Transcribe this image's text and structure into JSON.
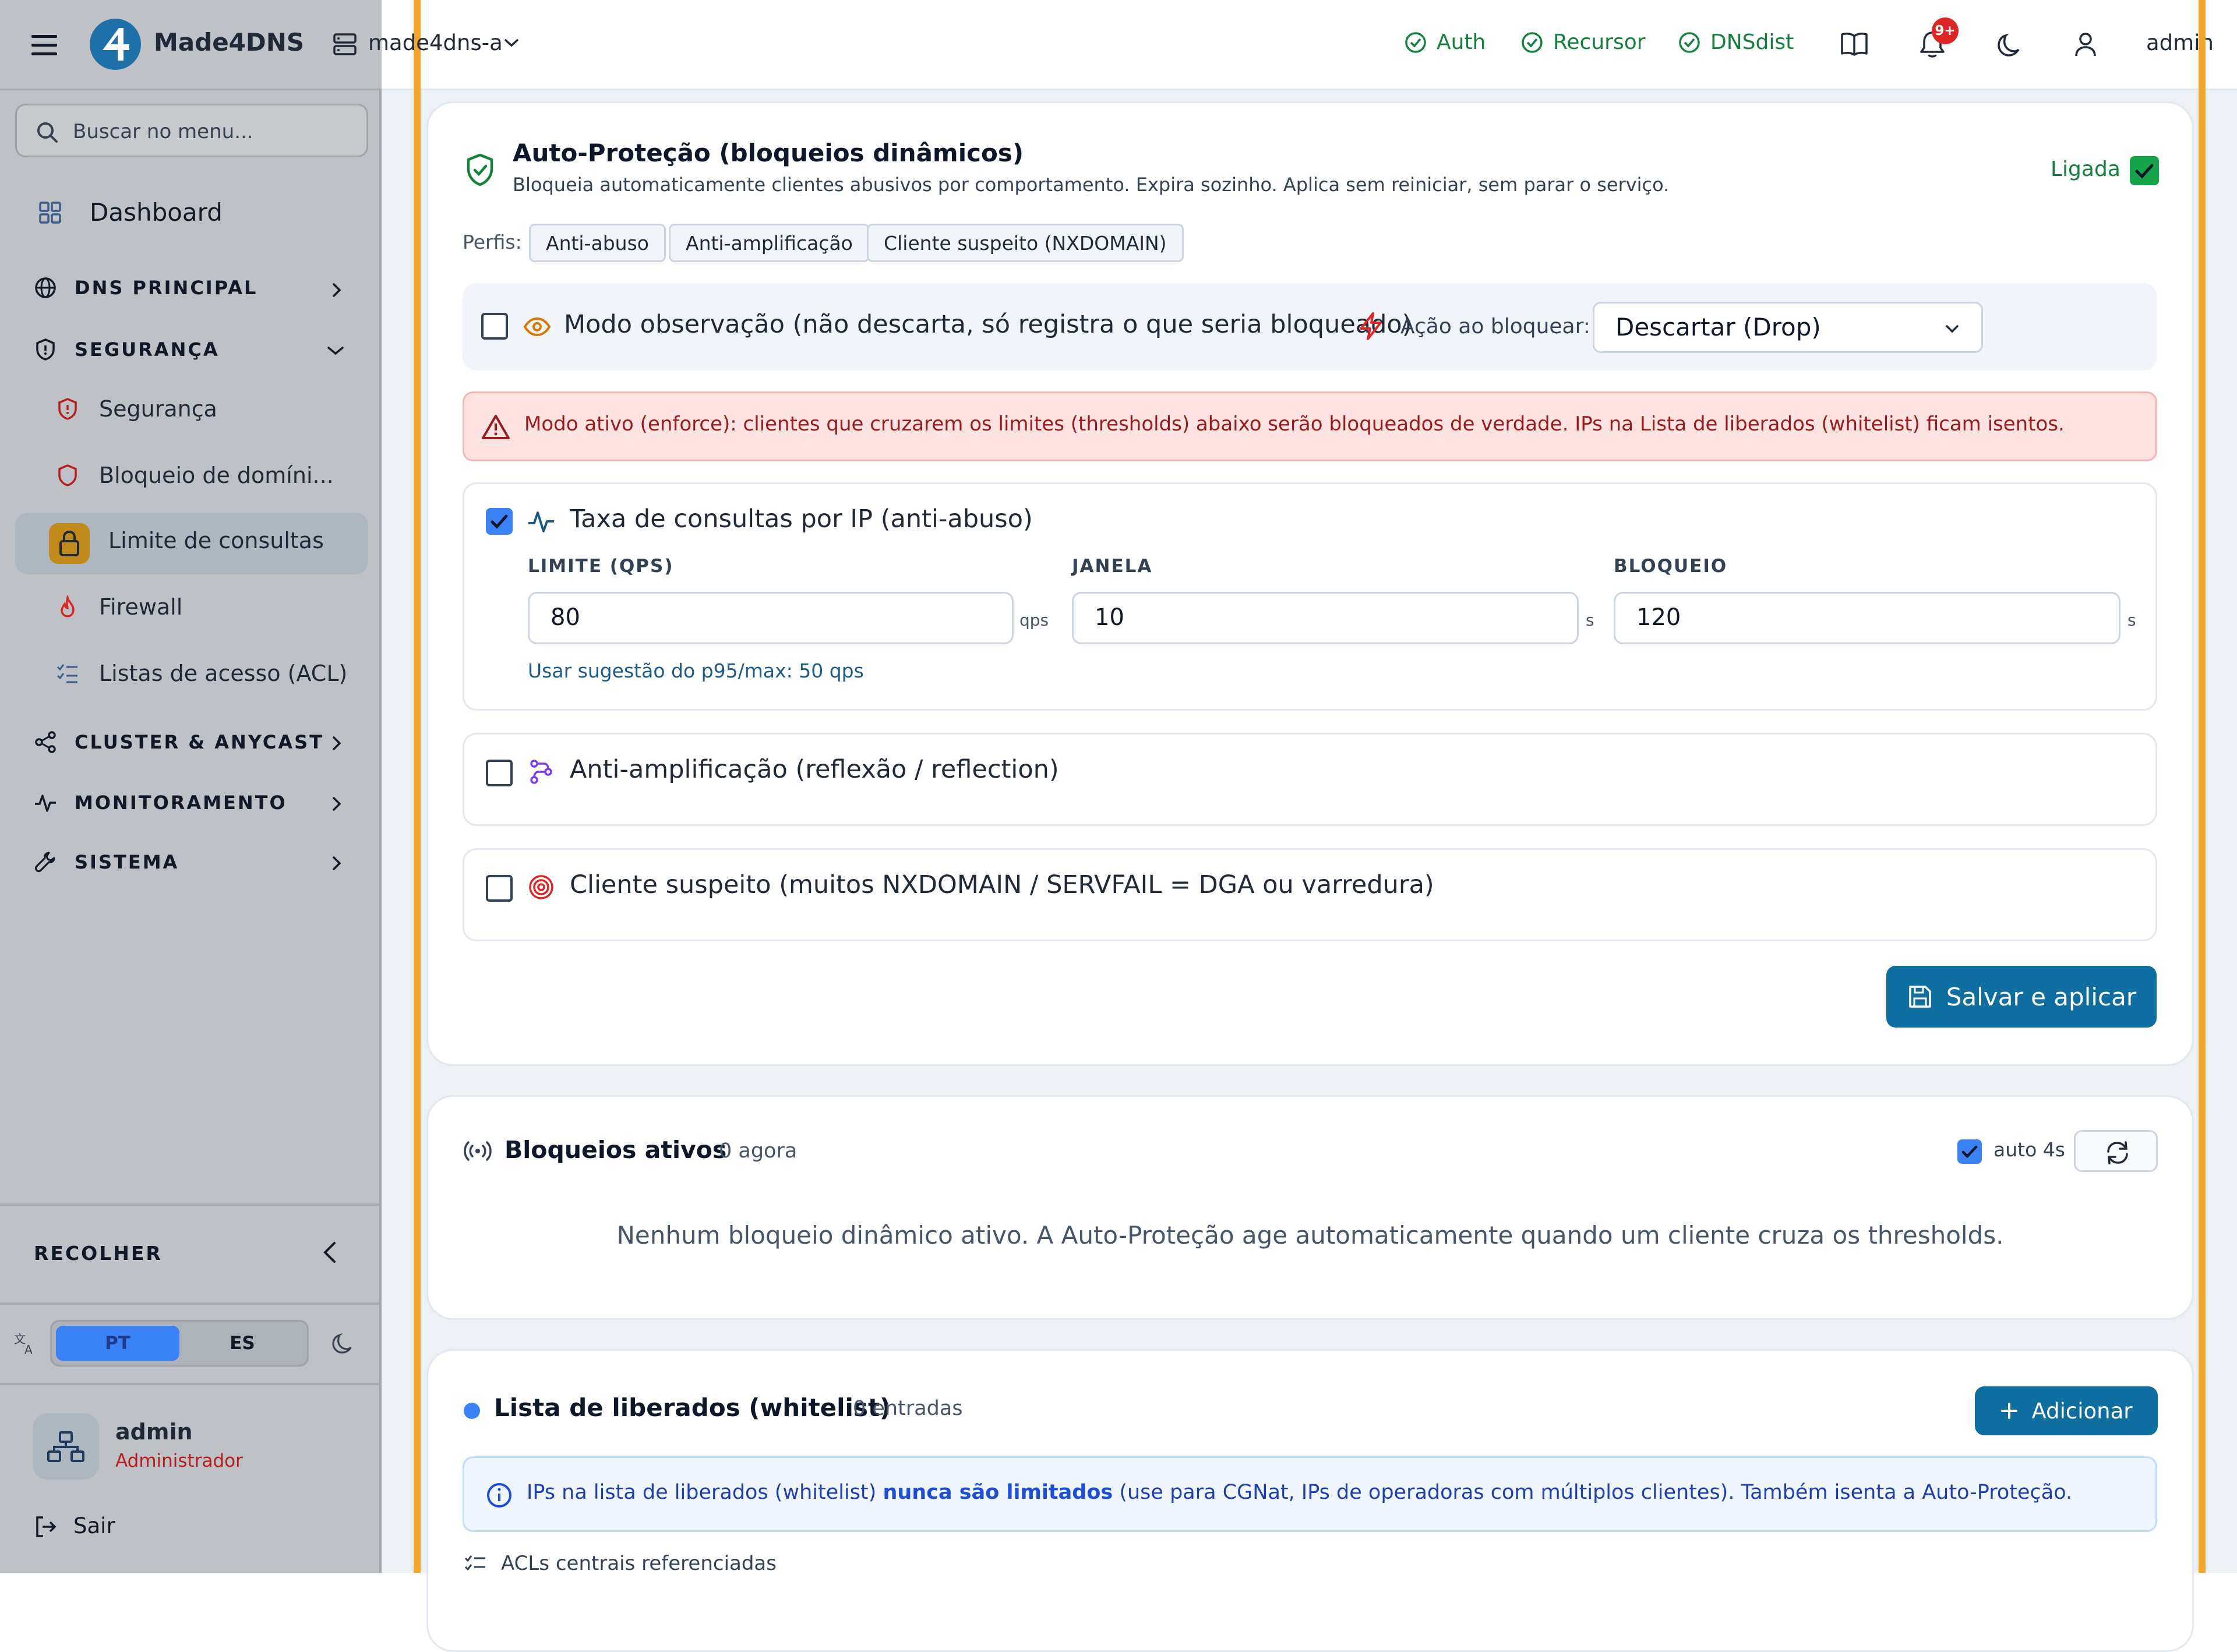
{
  "app": {
    "brand": "Made4DNS",
    "server_selector": "made4dns-a",
    "user_label": "admin"
  },
  "topbar": {
    "services": [
      {
        "label": "Auth"
      },
      {
        "label": "Recursor"
      },
      {
        "label": "DNSdist"
      }
    ],
    "notifications_badge": "9+"
  },
  "sidebar": {
    "search_placeholder": "Buscar no menu...",
    "dashboard": "Dashboard",
    "sections": {
      "dns_principal": "DNS PRINCIPAL",
      "seguranca": "SEGURANÇA",
      "cluster": "CLUSTER & ANYCAST",
      "monitoramento": "MONITORAMENTO",
      "sistema": "SISTEMA"
    },
    "security_items": {
      "seguranca": "Segurança",
      "bloqueio": "Bloqueio de domíni...",
      "limite": "Limite de consultas",
      "firewall": "Firewall",
      "acl": "Listas de acesso (ACL)"
    },
    "collapse_label": "RECOLHER",
    "languages": {
      "pt": "PT",
      "es": "ES",
      "selected": "PT"
    },
    "user": {
      "name": "admin",
      "role": "Administrador"
    },
    "logout": "Sair"
  },
  "autoprotect": {
    "title": "Auto-Proteção (bloqueios dinâmicos)",
    "description": "Bloqueia automaticamente clientes abusivos por comportamento. Expira sozinho. Aplica sem reiniciar, sem parar o serviço.",
    "enabled_label": "Ligada",
    "enabled": true,
    "profiles_label": "Perfis:",
    "profiles": {
      "p1": "Anti-abuso",
      "p2": "Anti-amplificação",
      "p3": "Cliente suspeito (NXDOMAIN)"
    },
    "observe_mode_label": "Modo observação (não descarta, só registra o que seria bloqueado)",
    "observe_mode": false,
    "action_label": "Ação ao bloquear:",
    "action_value": "Descartar (Drop)",
    "alert": "Modo ativo (enforce): clientes que cruzarem os limites (thresholds) abaixo serão bloqueados de verdade. IPs na Lista de liberados (whitelist) ficam isentos.",
    "rate": {
      "title": "Taxa de consultas por IP (anti-abuso)",
      "enabled": true,
      "limit_label": "LIMITE (QPS)",
      "limit_value": "80",
      "limit_unit": "qps",
      "window_label": "JANELA",
      "window_value": "10",
      "window_unit": "s",
      "block_label": "BLOQUEIO",
      "block_value": "120",
      "block_unit": "s",
      "suggestion": "Usar sugestão do p95/max: 50 qps"
    },
    "amplification": {
      "title": "Anti-amplificação (reflexão / reflection)",
      "enabled": false
    },
    "suspect": {
      "title": "Cliente suspeito (muitos NXDOMAIN / SERVFAIL = DGA ou varredura)",
      "enabled": false
    },
    "save_label": "Salvar e aplicar"
  },
  "active_blocks": {
    "title": "Bloqueios ativos",
    "meta": "0 agora",
    "auto_label": "auto 4s",
    "auto_enabled": true,
    "empty_text": "Nenhum bloqueio dinâmico ativo. A Auto-Proteção age automaticamente quando um cliente cruza os thresholds."
  },
  "whitelist": {
    "title": "Lista de liberados (whitelist)",
    "meta": "0 entradas",
    "add_label": "Adicionar",
    "info_prefix": "IPs na lista de liberados (whitelist)",
    "info_strong": "nunca são limitados",
    "info_suffix": "(use para CGNat, IPs de operadoras com múltiplos clientes). Também isenta a Auto-Proteção.",
    "acl_ref": "ACLs centrais referenciadas"
  },
  "colors": {
    "primary": "#0e6ea0",
    "success": "#15803d",
    "danger_bg": "#fde2e2",
    "danger_text": "#991b1b",
    "accent_orange": "#f4a52a",
    "sidebar_bg": "#bec2c6"
  }
}
